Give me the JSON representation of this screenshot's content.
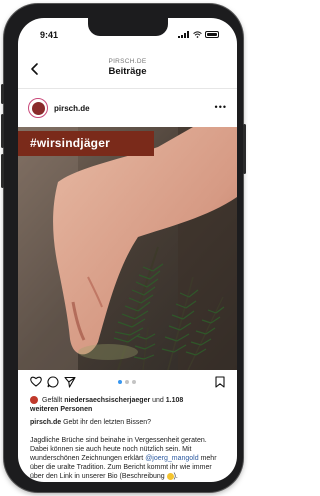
{
  "status_bar": {
    "time": "9:41"
  },
  "nav": {
    "account_small": "PIRSCH.DE",
    "title": "Beiträge",
    "back_icon": "chevron-left-icon"
  },
  "post": {
    "username": "pirsch.de",
    "more_icon": "more-horizontal-icon",
    "hashtag_overlay": "#wirsindjäger",
    "photo_description_icon": "hand-with-fir-branch-photo",
    "actions": {
      "like_icon": "heart-icon",
      "comment_icon": "comment-icon",
      "share_icon": "send-icon",
      "save_icon": "bookmark-icon"
    },
    "carousel": {
      "current": 1,
      "total": 3
    },
    "likes_prefix": "Gefällt",
    "likes_user": "niedersaechsischerjaeger",
    "likes_and": "und",
    "likes_count": "1.108",
    "likes_suffix": "weiteren Personen",
    "caption_user": "pirsch.de",
    "caption_line1": "Gebt ihr den letzten Bissen?",
    "caption_part1": "Jagdliche Brüche sind beinahe in Vergessenheit geraten. Dabei können sie auch heute noch nützlich sein. Mit wunderschönen Zeichnungen erklärt",
    "caption_mention": "@joerg_mangold",
    "caption_part2": "mehr über die uralte Tradition. Zum Bericht kommt ihr wie immer über den Link in unserer Bio (Beschreibung",
    "caption_end": ")."
  },
  "colors": {
    "hashtag_bg": "#7a2a1a",
    "mention": "#2c5aa0",
    "active_dot": "#3897f0"
  }
}
